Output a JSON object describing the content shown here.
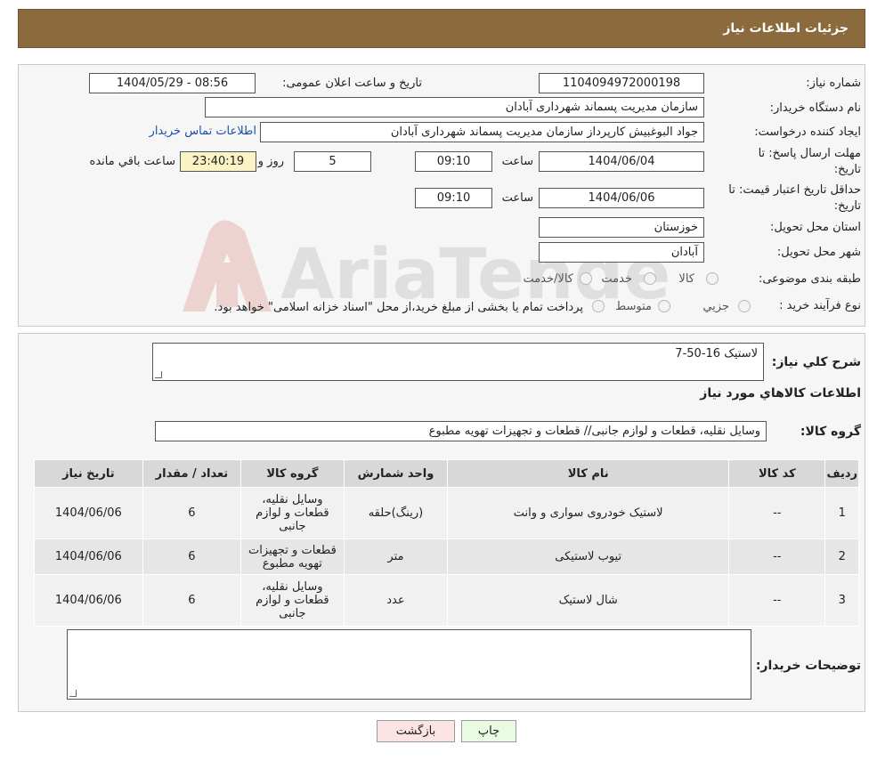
{
  "header": {
    "title": "جزئیات اطلاعات نیاز"
  },
  "form": {
    "need_number_label": "شماره نیاز:",
    "need_number": "1104094972000198",
    "announce_label": "تاریخ و ساعت اعلان عمومی:",
    "announce_value": "1404/05/29 - 08:56",
    "buyer_org_label": "نام دستگاه خریدار:",
    "buyer_org": "سازمان مدیریت پسماند شهرداری آبادان",
    "requester_label": "ایجاد کننده درخواست:",
    "requester": "جواد البوغبیش کارپرداز سازمان مدیریت پسماند شهرداری آبادان",
    "contact_link": "اطلاعات تماس خریدار",
    "deadline_label_1": "مهلت ارسال پاسخ: تا",
    "deadline_label_2": "تاریخ:",
    "deadline_date": "1404/06/04",
    "time_label": "ساعت",
    "deadline_time": "09:10",
    "days_value": "5",
    "days_label": "روز و",
    "remaining_time": "23:40:19",
    "remaining_label": "ساعت باقي مانده",
    "validity_label_1": "حداقل تاریخ اعتبار قیمت: تا",
    "validity_label_2": "تاریخ:",
    "validity_date": "1404/06/06",
    "validity_time": "09:10",
    "province_label": "استان محل تحویل:",
    "province": "خوزستان",
    "city_label": "شهر محل تحویل:",
    "city": "آبادان",
    "category_label": "طبقه بندی موضوعی:",
    "category_options": [
      "کالا",
      "خدمت",
      "کالا/خدمت"
    ],
    "process_label": "نوع فرآیند خرید :",
    "process_options": [
      "جزیي",
      "متوسط"
    ],
    "process_note": "پرداخت تمام یا بخشی از مبلغ خرید،از محل \"اسناد خزانه اسلامی\" خواهد بود."
  },
  "details": {
    "general_desc_label": "شرح كلي نیاز:",
    "general_desc": "لاستیک 16-50-7",
    "items_info_title": "اطلاعات كالاهاي مورد نیاز",
    "goods_group_label": "گروه كالا:",
    "goods_group": "وسایل نقلیه، قطعات و لوازم جانبی//  قطعات و تجهیزات تهویه مطبوع",
    "table": {
      "headers": [
        "ردیف",
        "کد کالا",
        "نام کالا",
        "واحد شمارش",
        "گروه کالا",
        "تعداد / مقدار",
        "تاریخ نیاز"
      ],
      "rows": [
        [
          "1",
          "--",
          "لاستیک خودروی سواری و وانت",
          "(رینگ)حلقه",
          "وسایل نقلیه، قطعات و لوازم جانبی",
          "6",
          "1404/06/06"
        ],
        [
          "2",
          "--",
          "تیوب لاستیکی",
          "متر",
          "قطعات و تجهیزات تهویه مطبوع",
          "6",
          "1404/06/06"
        ],
        [
          "3",
          "--",
          "شال لاستیک",
          "عدد",
          "وسایل نقلیه، قطعات و لوازم جانبی",
          "6",
          "1404/06/06"
        ]
      ]
    },
    "buyer_notes_label": "توضیحات خریدار:",
    "buyer_notes": ""
  },
  "buttons": {
    "print": "چاپ",
    "back": "بازگشت"
  },
  "colors": {
    "header_bg": "#8b6a3e",
    "link": "#1a4fa8",
    "remaining_bg": "#fbf3c3",
    "print_bg": "#eafbe4",
    "back_bg": "#fde4e4"
  },
  "watermark": {
    "text": "AriaTender.neT"
  }
}
